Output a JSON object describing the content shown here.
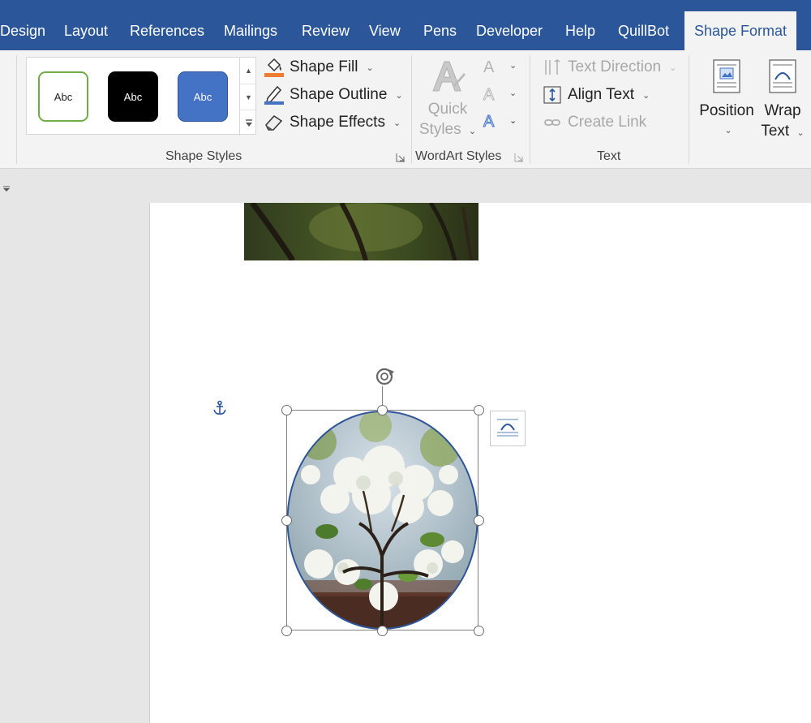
{
  "tabs": [
    "Design",
    "Layout",
    "References",
    "Mailings",
    "Review",
    "View",
    "Pens",
    "Developer",
    "Help",
    "QuillBot"
  ],
  "active_tab": "Shape Format",
  "ribbon": {
    "shape_styles": {
      "swatches": [
        "Abc",
        "Abc",
        "Abc"
      ],
      "fill": "Shape Fill",
      "outline": "Shape Outline",
      "effects": "Shape Effects",
      "group_label": "Shape Styles"
    },
    "wordart": {
      "quick_styles_line1": "Quick",
      "quick_styles_line2": "Styles",
      "group_label": "WordArt Styles"
    },
    "text": {
      "direction": "Text Direction",
      "align": "Align Text",
      "link": "Create Link",
      "group_label": "Text"
    },
    "arrange": {
      "position": "Position",
      "wrap_line1": "Wrap",
      "wrap_line2": "Text"
    }
  },
  "colors": {
    "tab_bar": "#2b579a",
    "ribbon": "#f3f3f3",
    "swatch_outline_green": "#70ad47",
    "swatch_black": "#000000",
    "swatch_blue": "#4472c4",
    "shape_outline": "#2f5597",
    "fill_accent": "#ed7d31"
  },
  "icons": [
    "paint-bucket-icon",
    "pencil-icon",
    "eraser-icon",
    "wordart-a-icon",
    "text-direction-icon",
    "align-text-icon",
    "link-icon",
    "position-icon",
    "wrap-text-icon",
    "anchor-icon",
    "rotate-icon",
    "layout-options-icon"
  ]
}
